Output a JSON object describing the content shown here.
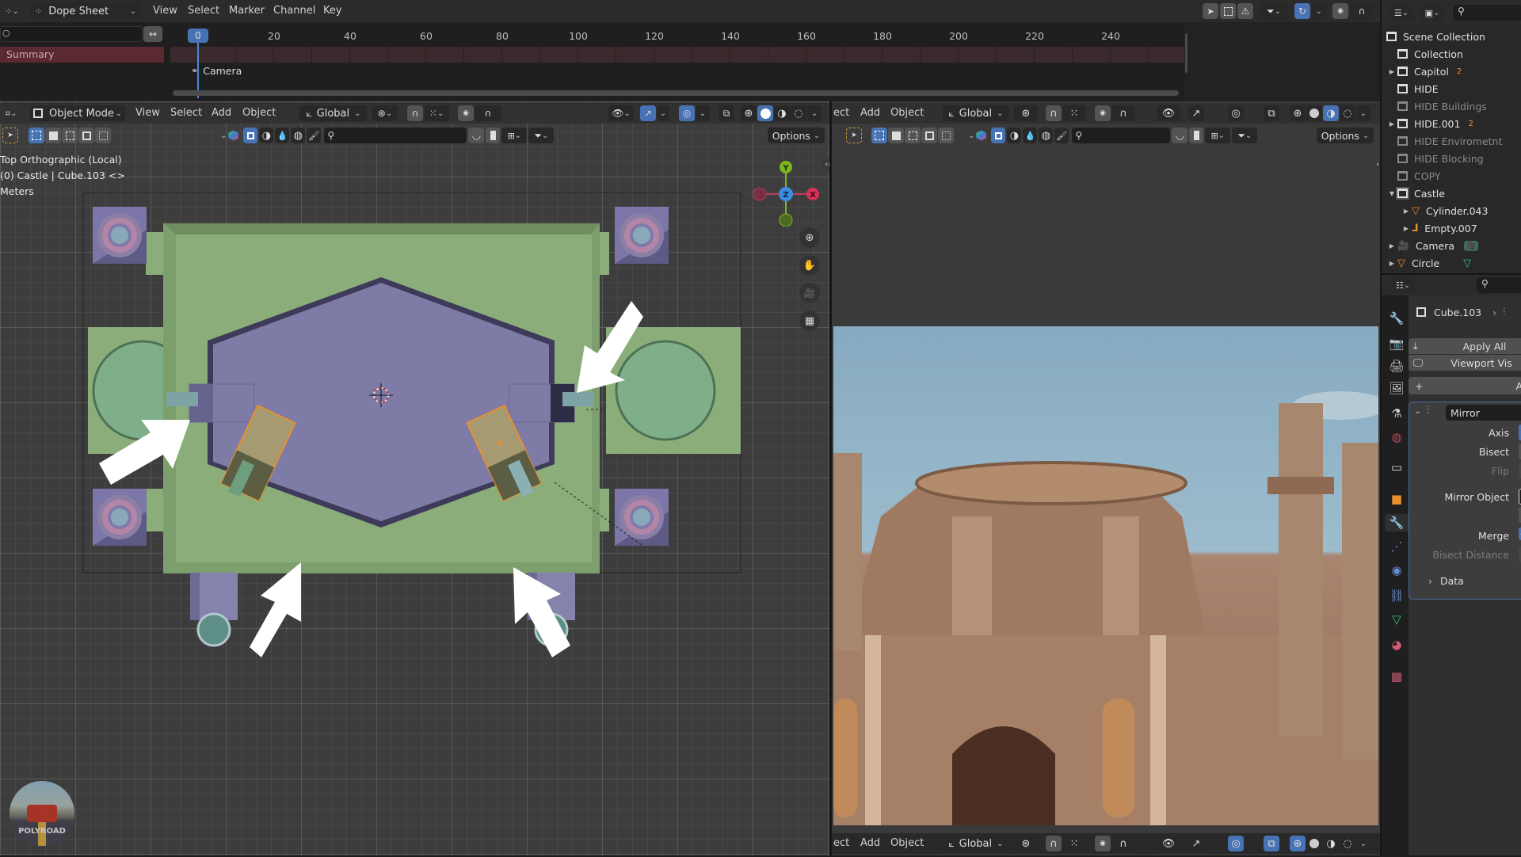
{
  "dope_sheet": {
    "editor_type": "Dope Sheet",
    "menus": [
      "View",
      "Select",
      "Marker",
      "Channel",
      "Key"
    ],
    "current_frame": "0",
    "frame_ticks": [
      "20",
      "40",
      "60",
      "80",
      "100",
      "120",
      "140",
      "160",
      "180",
      "200",
      "220",
      "240"
    ],
    "summary_label": "Summary",
    "channel_label": "Camera"
  },
  "viewport_left": {
    "mode": "Object Mode",
    "menus": [
      "View",
      "Select",
      "Add",
      "Object"
    ],
    "transform_orientation": "Global",
    "options_label": "Options",
    "overlay_lines": [
      "Top Orthographic (Local)",
      "(0) Castle | Cube.103 <>",
      "Meters"
    ],
    "gizmo_axes": {
      "y": "Y",
      "z": "Z",
      "x": "X"
    },
    "nav_buttons": [
      "zoom",
      "pan",
      "camera",
      "ortho-grid"
    ],
    "watermark": "POLYROAD"
  },
  "viewport_right": {
    "menus_partial": [
      "ect",
      "Add",
      "Object"
    ],
    "transform_orientation": "Global",
    "options_label": "Options"
  },
  "outliner": {
    "items": [
      {
        "label": "Scene Collection",
        "depth": 0,
        "type": "collection",
        "dim": false,
        "expand": ""
      },
      {
        "label": "Collection",
        "depth": 1,
        "type": "collection",
        "dim": false,
        "expand": ""
      },
      {
        "label": "Capitol",
        "depth": 1,
        "type": "collection",
        "dim": false,
        "expand": "▶",
        "badge": "2"
      },
      {
        "label": "HIDE",
        "depth": 1,
        "type": "collection",
        "dim": false,
        "expand": ""
      },
      {
        "label": "HIDE Buildings",
        "depth": 1,
        "type": "collection",
        "dim": true,
        "expand": ""
      },
      {
        "label": "HIDE.001",
        "depth": 1,
        "type": "collection",
        "dim": false,
        "expand": "▶",
        "badge": "2"
      },
      {
        "label": "HIDE Envirometnt",
        "depth": 1,
        "type": "collection",
        "dim": true,
        "expand": ""
      },
      {
        "label": "HIDE Blocking",
        "depth": 1,
        "type": "collection",
        "dim": true,
        "expand": ""
      },
      {
        "label": "COPY",
        "depth": 1,
        "type": "collection",
        "dim": true,
        "expand": ""
      },
      {
        "label": "Castle",
        "depth": 1,
        "type": "collection",
        "dim": false,
        "expand": "▼"
      },
      {
        "label": "Cylinder.043",
        "depth": 2,
        "type": "mesh",
        "dim": false,
        "expand": "▶"
      },
      {
        "label": "Empty.007",
        "depth": 2,
        "type": "empty",
        "dim": false,
        "expand": "▶"
      },
      {
        "label": "Camera",
        "depth": 1,
        "type": "camera",
        "dim": false,
        "expand": "▶"
      },
      {
        "label": "Circle",
        "depth": 1,
        "type": "mesh",
        "dim": false,
        "expand": "▶"
      }
    ]
  },
  "properties": {
    "object_name": "Cube.103",
    "apply_all": "Apply All",
    "viewport_vis": "Viewport Vis",
    "add_modifier": "A",
    "modifier": {
      "name": "Mirror",
      "fields": [
        {
          "label": "Axis",
          "dim": false
        },
        {
          "label": "Bisect",
          "dim": false
        },
        {
          "label": "Flip",
          "dim": true
        },
        {
          "label": "Mirror Object",
          "dim": false
        },
        {
          "label": "Merge",
          "dim": false,
          "checked": true
        },
        {
          "label": "Bisect Distance",
          "dim": true
        }
      ],
      "data_section": "Data"
    },
    "tabs": [
      "tool",
      "render",
      "output",
      "view-layer",
      "scene",
      "world",
      "collection",
      "object",
      "modifiers",
      "particles",
      "physics",
      "constraints",
      "data",
      "material",
      "texture"
    ]
  },
  "colors": {
    "accent": "#4772b3",
    "summary_bg": "#5a2a30",
    "ground_green": "#8aad7a",
    "hex_purple": "#7e7ca6",
    "selection_orange": "#e8902e"
  }
}
